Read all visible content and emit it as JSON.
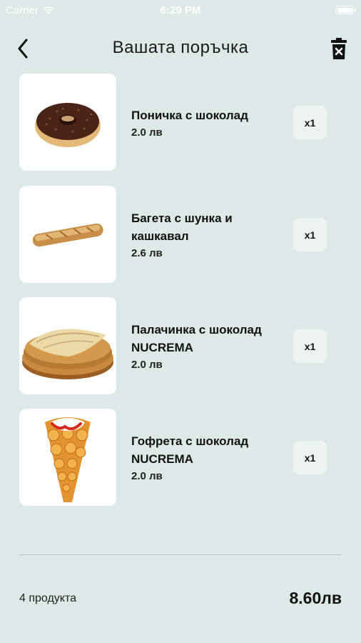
{
  "status_bar": {
    "carrier": "Carrier",
    "time": "6:29 PM",
    "battery_level": 1.0
  },
  "header": {
    "title": "Вашата поръчка"
  },
  "icons": {
    "back": "chevron-left-icon",
    "trash": "trash-icon"
  },
  "items": [
    {
      "name": "Поничка с шоколад",
      "price": "2.0 лв",
      "qty": "x1",
      "image": "chocolate-donut"
    },
    {
      "name": "Багета с шунка и кашкавал",
      "price": "2.6 лв",
      "qty": "x1",
      "image": "baguette"
    },
    {
      "name": "Палачинка с шоколад NUCREMA",
      "price": "2.0 лв",
      "qty": "x1",
      "image": "pancakes"
    },
    {
      "name": "Гофрета с шоколад NUCREMA",
      "price": "2.0 лв",
      "qty": "x1",
      "image": "bubble-waffle"
    }
  ],
  "footer": {
    "count_label": "4 продукта",
    "total": "8.60лв"
  },
  "colors": {
    "background": "#dde9e9",
    "card": "#ffffff",
    "qty_button": "#edf3f3",
    "text": "#111111"
  }
}
